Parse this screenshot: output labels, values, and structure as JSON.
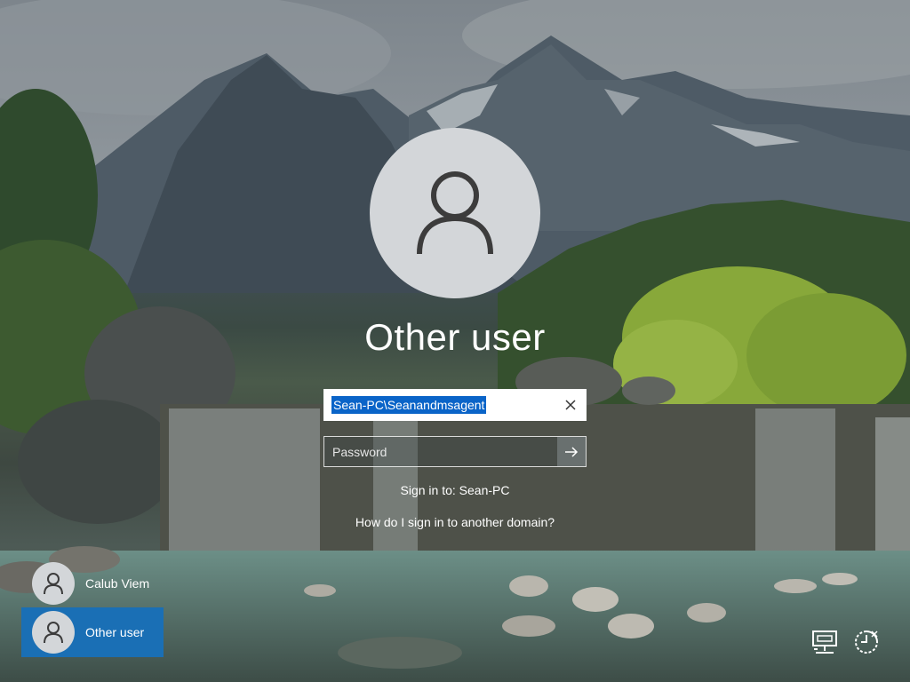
{
  "login": {
    "display_name": "Other user",
    "username_value": "Sean-PC\\Seanandmsagent",
    "password_placeholder": "Password",
    "sign_in_to": "Sign in to: Sean-PC",
    "domain_help_link": "How do I sign in to another domain?"
  },
  "users": [
    {
      "name": "Calub Viem",
      "selected": false
    },
    {
      "name": "Other user",
      "selected": true
    }
  ],
  "icons": {
    "avatar": "person-icon",
    "clear": "close-icon",
    "submit": "arrow-right-icon",
    "network": "network-icon",
    "accessibility": "ease-of-access-icon",
    "power": "power-icon"
  },
  "colors": {
    "selection_highlight": "#0a64c8",
    "selected_user_tile": "#1a6fb5",
    "avatar_background": "#d3d6d9",
    "text": "#ffffff"
  }
}
